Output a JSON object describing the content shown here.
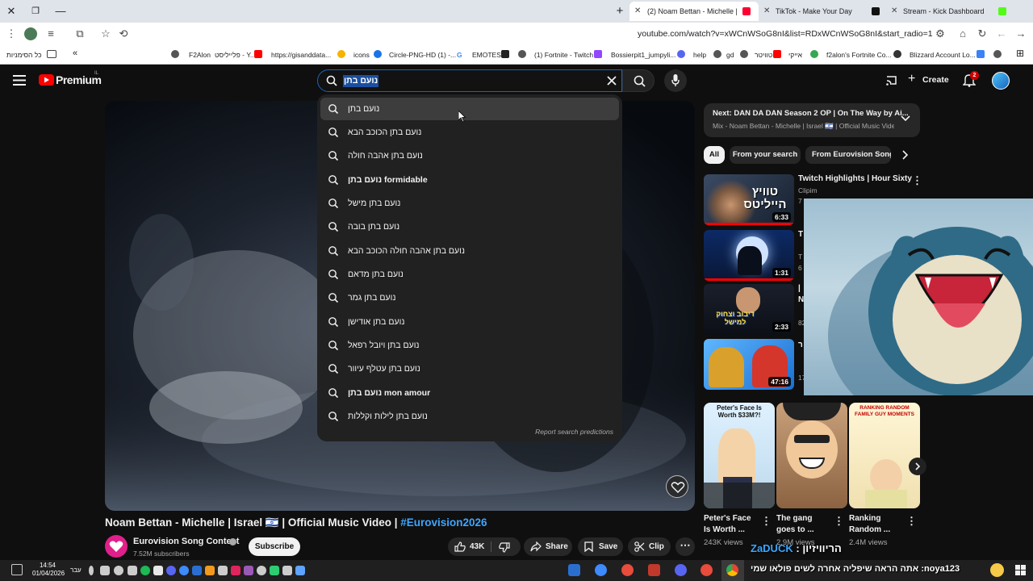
{
  "browser": {
    "tabs": [
      {
        "title": "(2) Noam Bettan - Michelle | Is",
        "active": true
      },
      {
        "title": "TikTok - Make Your Day",
        "active": false
      },
      {
        "title": "Stream - Kick Dashboard",
        "active": false
      }
    ],
    "url": "youtube.com/watch?v=xWCnWSoG8nI&list=RDxWCnWSoG8nI&start_radio=1",
    "bookmarks": [
      "פלייליסט - Y...",
      "F2Alon",
      "https://gisanddata...",
      "icons",
      "Circle-PNG-HD (1) -...",
      "EMOTES",
      "(1) Fortnite - Twitch",
      "Bossierpit1_jumpyli...",
      "help",
      "gd",
      "טוויטר",
      "אייקי",
      "f2alon's Fortnite Co...",
      "Blizzard Account Lo..."
    ],
    "all_bookmarks": "כל הסימניות"
  },
  "yt": {
    "logo": "Premium",
    "logo_sup": "IL",
    "query": "נועם בתן",
    "create": "Create",
    "notif_count": "2",
    "suggestions": [
      "נועם בתן",
      "נועם בתן הכוכב הבא",
      "נועם בתן אהבה חולה",
      "נועם בתן formidable",
      "נועם בתן מישל",
      "נועם בתן בובה",
      "נועם בתן אהבה חולה הכוכב הבא",
      "נועם בתן מדאם",
      "נועם בתן גמר",
      "נועם בתן אודישן",
      "נועם בתן ויובל רפאל",
      "נועם בתן עטלף עיוור",
      "נועם בתן mon amour",
      "נועם בתן לילות וקללות"
    ],
    "report": "Report search predictions"
  },
  "sidebar": {
    "next_label": "Next:",
    "next_title": "DAN DA DAN Season 2 OP | On The Way by Ai...",
    "next_sub": "Mix - Noam Bettan - Michelle | Israel 🇮🇱 | Official Music Video ...",
    "chips": [
      "All",
      "From your search",
      "From Eurovision Song C"
    ],
    "recs": [
      {
        "title": "Twitch Highlights | Hour Sixty",
        "meta": "Clipim",
        "extra": "7",
        "duration": "6:33",
        "thumb_text": "טוויץ הייליטס"
      },
      {
        "title": "T",
        "meta": "T",
        "extra": "6",
        "duration": "1:31",
        "thumb_text": ""
      },
      {
        "title": "|",
        "meta": "N",
        "extra": "82",
        "duration": "2:33",
        "thumb_text": "דיבוב וצחוק למישל"
      },
      {
        "title": "ר",
        "meta": "17",
        "extra": "",
        "duration": "47:16",
        "thumb_text": ""
      }
    ],
    "shorts": [
      {
        "title": "Peter's Face Is Worth ...",
        "views": "243K views",
        "thumb_text": "Peter's Face Is Worth $33M?!"
      },
      {
        "title": "The gang goes to ...",
        "views": "2.9M views",
        "thumb_text": ""
      },
      {
        "title": "Ranking Random ...",
        "views": "2.4M views",
        "thumb_text": "RANKING RANDOM FAMILY GUY MOMENTS"
      }
    ]
  },
  "video": {
    "title": "Noam Bettan - Michelle | Israel 🇮🇱 | Official Music Video |",
    "hashtag": "#Eurovision2026",
    "channel": "Eurovision Song Contest",
    "subscribers": "7.52M subscribers",
    "subscribe": "Subscribe",
    "likes": "43K",
    "share": "Share",
    "save": "Save",
    "clip": "Clip"
  },
  "overlay": {
    "chat_user": "ZaDUCK",
    "chat_text": ": הריוויזיון",
    "ticker": "אתה הראה שיפליה אחרה לשים פולאו שמי :noya123"
  },
  "taskbar": {
    "time": "14:54",
    "date": "01/04/2026",
    "lang": "עבר"
  },
  "colors": {
    "accent_blue": "#3ea6ff",
    "yt_red": "#ff0000",
    "search_border": "#1c62b9",
    "bg": "#0f0f0f"
  },
  "icons": [
    "close-icon",
    "restore-icon",
    "minimize-icon",
    "new-tab-icon",
    "menu-dots-icon",
    "extension-icon",
    "star-icon",
    "home-icon",
    "reload-icon",
    "back-icon",
    "forward-icon",
    "hamburger-icon",
    "search-icon",
    "clear-icon",
    "mic-icon",
    "create-plus-icon",
    "bell-icon",
    "like-icon",
    "dislike-icon",
    "share-icon",
    "save-icon",
    "clip-icon",
    "more-icon",
    "chevron-down-icon",
    "chevron-right-icon"
  ]
}
